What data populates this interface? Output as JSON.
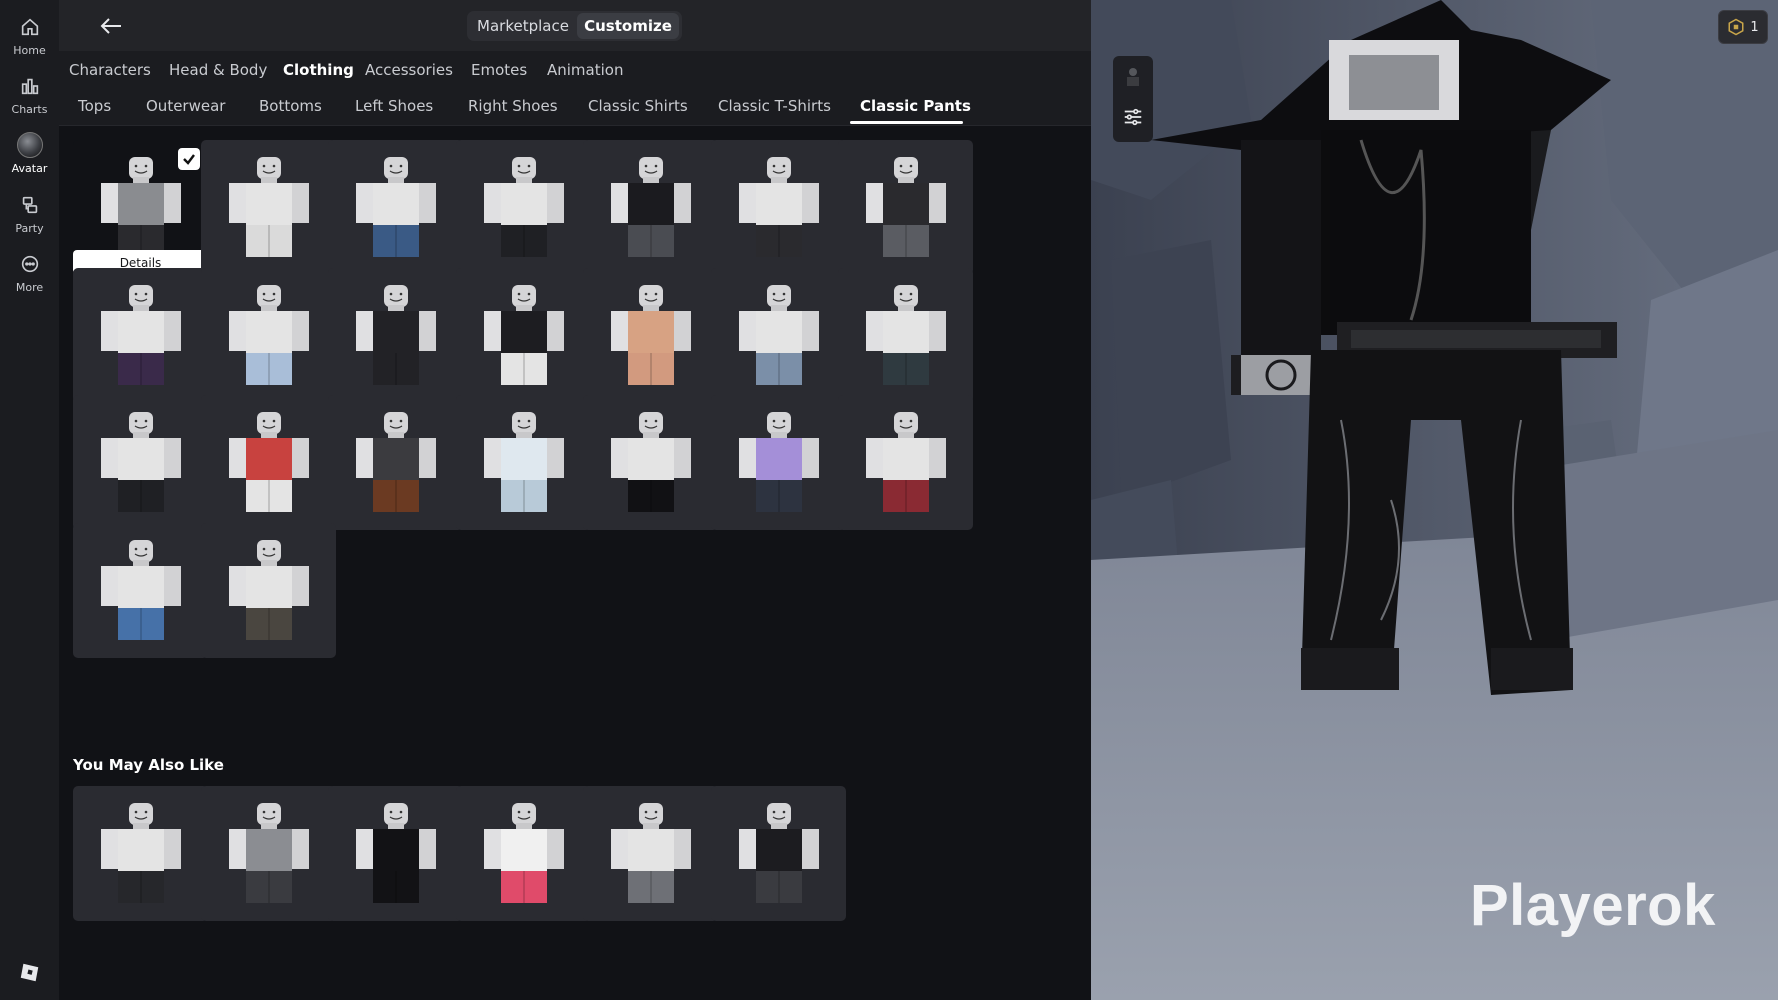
{
  "rail": {
    "items": [
      {
        "label": "Home",
        "icon": "home-icon"
      },
      {
        "label": "Charts",
        "icon": "charts-icon"
      },
      {
        "label": "Avatar",
        "icon": "avatar-icon"
      },
      {
        "label": "Party",
        "icon": "party-icon"
      },
      {
        "label": "More",
        "icon": "more-icon"
      }
    ]
  },
  "topbar": {
    "marketplace_label": "Marketplace",
    "customize_label": "Customize",
    "active": "Customize"
  },
  "categories": {
    "items": [
      "Characters",
      "Head & Body",
      "Clothing",
      "Accessories",
      "Emotes",
      "Animation"
    ],
    "active": "Clothing"
  },
  "subtabs": {
    "items": [
      "Tops",
      "Outerwear",
      "Bottoms",
      "Left Shoes",
      "Right Shoes",
      "Classic Shirts",
      "Classic T-Shirts",
      "Classic Pants"
    ],
    "active": "Classic Pants"
  },
  "grid": {
    "details_label": "Details",
    "items": [
      {
        "torso": "#8a8c90",
        "legs": "#2a2a2e",
        "selected": true
      },
      {
        "torso": "#e4e4e4",
        "legs": "#dadada",
        "selected": false
      },
      {
        "torso": "#e4e4e4",
        "legs": "#3a5a85",
        "selected": false
      },
      {
        "torso": "#e4e4e4",
        "legs": "#1f2024",
        "selected": false
      },
      {
        "torso": "#1b1b1f",
        "legs": "#4a4c52",
        "selected": false
      },
      {
        "torso": "#e4e4e4",
        "legs": "#2a2a2e",
        "selected": false
      },
      {
        "torso": "#2a2a2e",
        "legs": "#5a5c62",
        "selected": false
      },
      {
        "torso": "#e4e4e4",
        "legs": "#3a2a4a",
        "selected": false
      },
      {
        "torso": "#e4e4e4",
        "legs": "#a9bed8",
        "selected": false
      },
      {
        "torso": "#222226",
        "legs": "#222226",
        "selected": false
      },
      {
        "torso": "#1d1d21",
        "legs": "#e4e4e4",
        "selected": false
      },
      {
        "torso": "#d7a283",
        "legs": "#d29a7f",
        "selected": false
      },
      {
        "torso": "#e4e4e4",
        "legs": "#7b8fa8",
        "selected": false
      },
      {
        "torso": "#e4e4e4",
        "legs": "#2f3a40",
        "selected": false
      },
      {
        "torso": "#e4e4e4",
        "legs": "#1f2024",
        "selected": false
      },
      {
        "torso": "#c8423f",
        "legs": "#e4e4e4",
        "selected": false
      },
      {
        "torso": "#3b3b3f",
        "legs": "#6b3a22",
        "selected": false
      },
      {
        "torso": "#dfe8ef",
        "legs": "#b8cad8",
        "selected": false
      },
      {
        "torso": "#e4e4e4",
        "legs": "#111114",
        "selected": false
      },
      {
        "torso": "#a48fd8",
        "legs": "#2d3340",
        "selected": false
      },
      {
        "torso": "#e4e4e4",
        "legs": "#8a2a33",
        "selected": false
      },
      {
        "torso": "#e4e4e4",
        "legs": "#4671a8",
        "selected": false
      },
      {
        "torso": "#e4e4e4",
        "legs": "#4a4640",
        "selected": false
      }
    ]
  },
  "recommended": {
    "title": "You May Also Like",
    "items": [
      {
        "torso": "#e4e4e4",
        "legs": "#26272b"
      },
      {
        "torso": "#8b8d92",
        "legs": "#3a3b40"
      },
      {
        "torso": "#121215",
        "legs": "#121215"
      },
      {
        "torso": "#f0f0f0",
        "legs": "#e04b6a"
      },
      {
        "torso": "#e4e4e4",
        "legs": "#6e7076"
      },
      {
        "torso": "#1c1c20",
        "legs": "#3a3b40"
      }
    ]
  },
  "viewport": {
    "player_name": "Playerok",
    "robux_count": "1"
  }
}
